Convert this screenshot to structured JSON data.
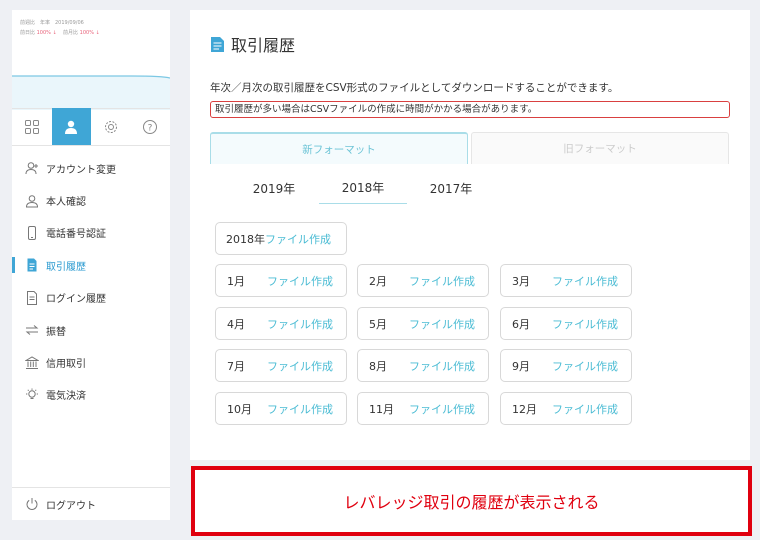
{
  "sidebar": {
    "stats_line1": "前週比　年率　2019/09/06",
    "stats_line2a": "前日比",
    "stats_pct2a": "100% ↓",
    "stats_line2b": "前月比",
    "stats_pct2b": "100% ↓",
    "tabs": [
      {
        "icon": "grid-icon",
        "active": false
      },
      {
        "icon": "user-icon",
        "active": true
      },
      {
        "icon": "gear-icon",
        "active": false
      },
      {
        "icon": "help-icon",
        "active": false
      }
    ],
    "items": [
      {
        "label": "アカウント変更",
        "icon": "user-add-icon"
      },
      {
        "label": "本人確認",
        "icon": "person-icon"
      },
      {
        "label": "電話番号認証",
        "icon": "phone-icon"
      },
      {
        "label": "取引履歴",
        "icon": "document-icon",
        "active": true
      },
      {
        "label": "ログイン履歴",
        "icon": "file-icon"
      },
      {
        "label": "振替",
        "icon": "transfer-icon"
      },
      {
        "label": "信用取引",
        "icon": "bank-icon"
      },
      {
        "label": "電気決済",
        "icon": "bulb-icon"
      }
    ],
    "logout_label": "ログアウト"
  },
  "main": {
    "title": "取引履歴",
    "description": "年次／月次の取引履歴をCSV形式のファイルとしてダウンロードすることができます。",
    "notice": "取引履歴が多い場合はCSVファイルの作成に時間がかかる場合があります。",
    "tabs": [
      {
        "label": "新フォーマット",
        "active": true
      },
      {
        "label": "旧フォーマット",
        "active": false
      }
    ],
    "years": [
      {
        "label": "2019年",
        "active": false
      },
      {
        "label": "2018年",
        "active": true
      },
      {
        "label": "2017年",
        "active": false
      }
    ],
    "year_button": {
      "label": "2018年",
      "action": "ファイル作成"
    },
    "months": [
      {
        "label": "1月",
        "action": "ファイル作成"
      },
      {
        "label": "2月",
        "action": "ファイル作成"
      },
      {
        "label": "3月",
        "action": "ファイル作成"
      },
      {
        "label": "4月",
        "action": "ファイル作成"
      },
      {
        "label": "5月",
        "action": "ファイル作成"
      },
      {
        "label": "6月",
        "action": "ファイル作成"
      },
      {
        "label": "7月",
        "action": "ファイル作成"
      },
      {
        "label": "8月",
        "action": "ファイル作成"
      },
      {
        "label": "9月",
        "action": "ファイル作成"
      },
      {
        "label": "10月",
        "action": "ファイル作成"
      },
      {
        "label": "11月",
        "action": "ファイル作成"
      },
      {
        "label": "12月",
        "action": "ファイル作成"
      }
    ]
  },
  "callout": {
    "text": "レバレッジ取引の履歴が表示される"
  },
  "colors": {
    "accent": "#3fa6d6",
    "action": "#4bbcd4",
    "alert": "#e0000f"
  }
}
